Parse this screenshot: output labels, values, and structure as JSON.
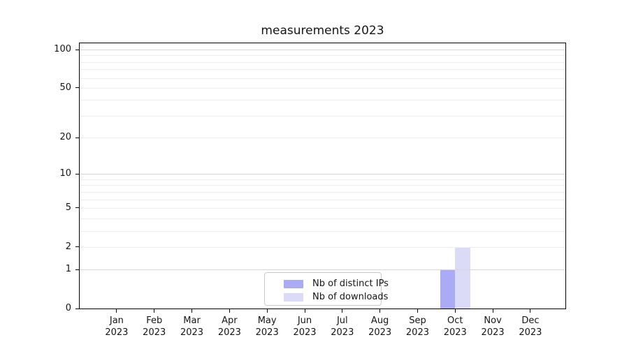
{
  "chart_data": {
    "type": "bar",
    "title": "measurements 2023",
    "categories": [
      "Jan 2023",
      "Feb 2023",
      "Mar 2023",
      "Apr 2023",
      "May 2023",
      "Jun 2023",
      "Jul 2023",
      "Aug 2023",
      "Sep 2023",
      "Oct 2023",
      "Nov 2023",
      "Dec 2023"
    ],
    "series": [
      {
        "name": "Nb of distinct IPs",
        "color": "#aaaaf5",
        "values": [
          0,
          0,
          0,
          0,
          0,
          0,
          0,
          0,
          0,
          1,
          0,
          0
        ]
      },
      {
        "name": "Nb of downloads",
        "color": "#dbdbf8",
        "values": [
          0,
          0,
          0,
          0,
          0,
          0,
          0,
          0,
          0,
          2,
          0,
          0
        ]
      }
    ],
    "xlabel": "",
    "ylabel": "",
    "yscale": "log1p",
    "ylim": [
      0,
      112
    ],
    "y_ticks": [
      0,
      1,
      2,
      5,
      10,
      20,
      50,
      100
    ],
    "grid": {
      "on": true,
      "major_values": [
        1,
        10,
        100
      ],
      "minor_values": [
        2,
        3,
        4,
        5,
        6,
        7,
        8,
        9,
        20,
        30,
        40,
        50,
        60,
        70,
        80,
        90
      ],
      "major_color": "#d6d6d6",
      "minor_color": "#ededed"
    },
    "legend_position": "lower center",
    "text_color": "#151515",
    "spine_color": "#000000"
  }
}
